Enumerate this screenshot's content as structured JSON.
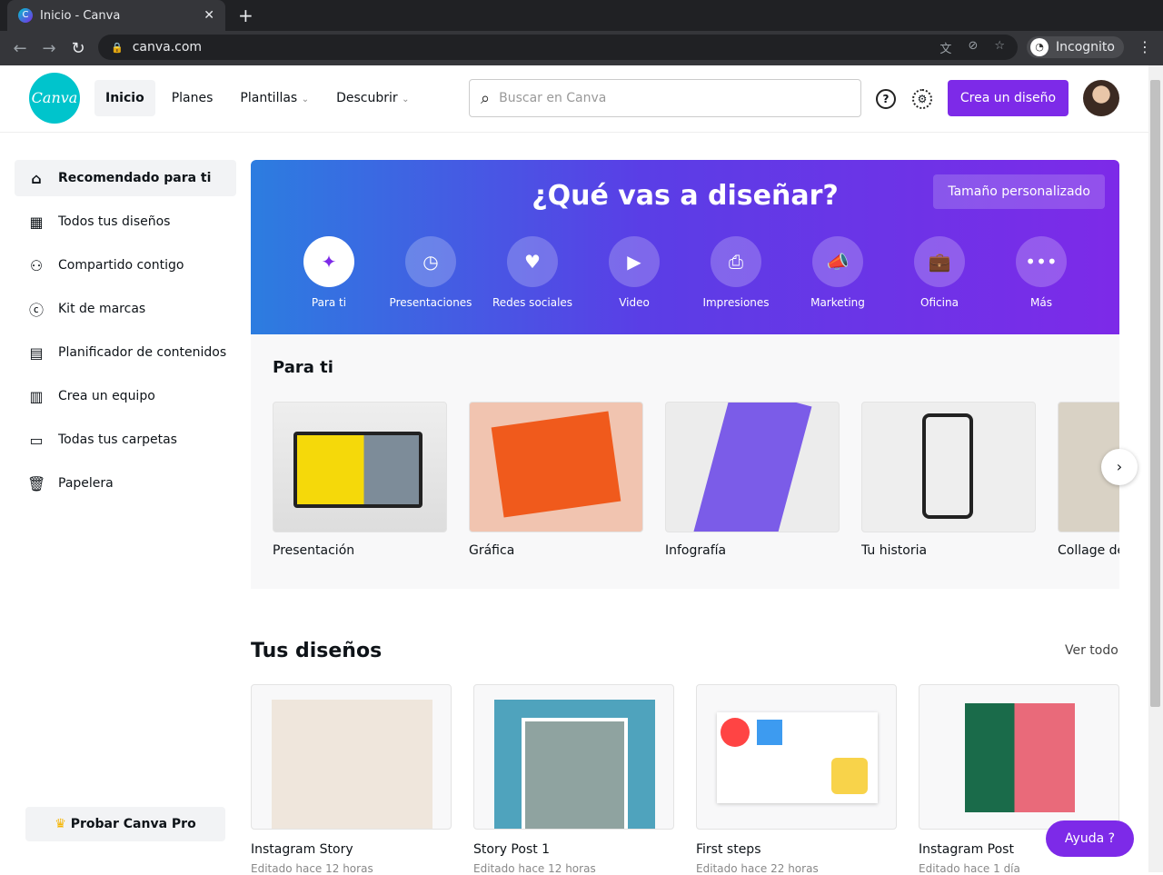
{
  "browser": {
    "tab_title": "Inicio - Canva",
    "url": "canva.com",
    "profile": "Incognito"
  },
  "header": {
    "logo": "Canva",
    "nav": [
      "Inicio",
      "Planes",
      "Plantillas",
      "Descubrir"
    ],
    "search_placeholder": "Buscar en Canva",
    "cta": "Crea un diseño"
  },
  "sidebar": {
    "items": [
      {
        "label": "Recomendado para ti",
        "icon": "home-icon"
      },
      {
        "label": "Todos tus diseños",
        "icon": "grid-icon"
      },
      {
        "label": "Compartido contigo",
        "icon": "users-icon"
      },
      {
        "label": "Kit de marcas",
        "icon": "brand-icon"
      },
      {
        "label": "Planificador de contenidos",
        "icon": "calendar-icon"
      },
      {
        "label": "Crea un equipo",
        "icon": "building-icon"
      },
      {
        "label": "Todas tus carpetas",
        "icon": "folder-icon"
      },
      {
        "label": "Papelera",
        "icon": "trash-icon"
      }
    ],
    "pro": "Probar Canva Pro"
  },
  "banner": {
    "title": "¿Qué vas a diseñar?",
    "custom_size": "Tamaño personalizado",
    "categories": [
      "Para ti",
      "Presentaciones",
      "Redes sociales",
      "Video",
      "Impresiones",
      "Marketing",
      "Oficina",
      "Más"
    ]
  },
  "for_you": {
    "title": "Para ti",
    "templates": [
      "Presentación",
      "Gráfica",
      "Infografía",
      "Tu historia",
      "Collage de"
    ]
  },
  "designs": {
    "title": "Tus diseños",
    "see_all": "Ver todo",
    "items": [
      {
        "name": "Instagram Story",
        "edited": "Editado hace 12 horas"
      },
      {
        "name": "Story Post 1",
        "edited": "Editado hace 12 horas"
      },
      {
        "name": "First steps",
        "edited": "Editado hace 22 horas"
      },
      {
        "name": "Instagram Post",
        "edited": "Editado hace 1 día"
      }
    ]
  },
  "help": "Ayuda  ?",
  "colors": {
    "accent": "#7d2ae8",
    "logo": "#00c4cc"
  }
}
